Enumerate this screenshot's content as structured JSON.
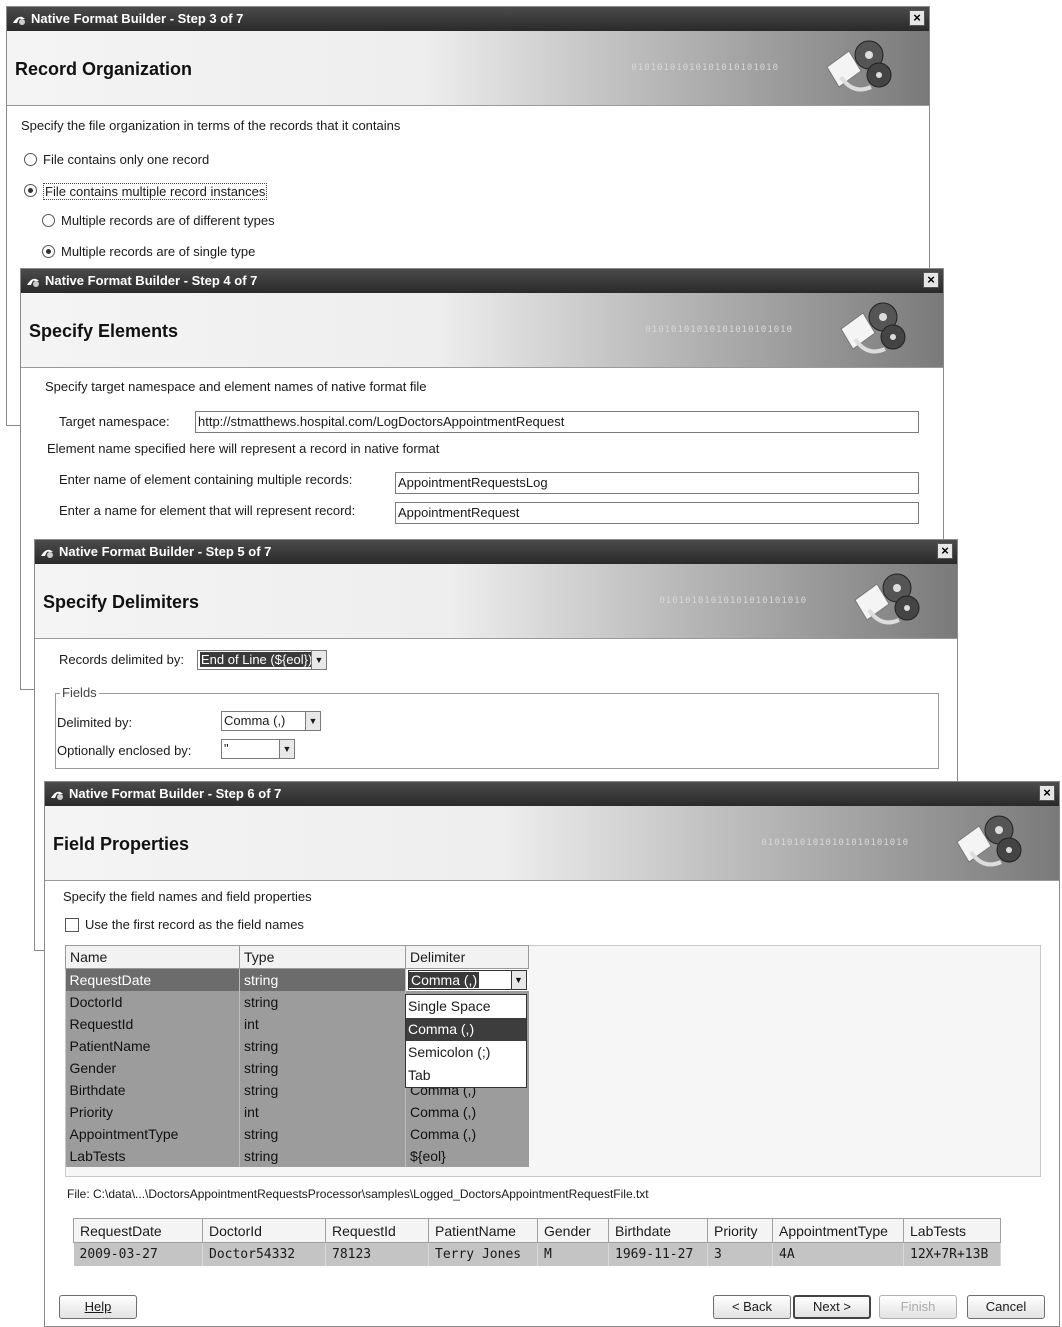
{
  "step3": {
    "title": "Native Format Builder - Step 3 of 7",
    "heading": "Record Organization",
    "instruction": "Specify the file organization in terms of the records that it contains",
    "options": [
      {
        "label": "File contains only one record",
        "selected": false
      },
      {
        "label": "File contains multiple record instances",
        "selected": true
      }
    ],
    "suboptions": [
      {
        "label": "Multiple records are of different types",
        "selected": false
      },
      {
        "label": "Multiple records are of single type",
        "selected": true
      }
    ]
  },
  "step4": {
    "title": "Native Format Builder - Step 4 of 7",
    "heading": "Specify Elements",
    "instruction": "Specify target namespace and element names of native format file",
    "namespace_label": "Target namespace:",
    "namespace_value": "http://stmatthews.hospital.com/LogDoctorsAppointmentRequest",
    "element_note": "Element name specified here will represent a record in native format",
    "multi_label": "Enter name of element containing multiple records:",
    "multi_value": "AppointmentRequestsLog",
    "record_label": "Enter a name for element that will represent record:",
    "record_value": "AppointmentRequest"
  },
  "step5": {
    "title": "Native Format Builder - Step 5 of 7",
    "heading": "Specify Delimiters",
    "records_label": "Records delimited by:",
    "records_value": "End of Line (${eol})",
    "fields_legend": "Fields",
    "delimited_label": "Delimited by:",
    "delimited_value": "Comma (,)",
    "enclosed_label": "Optionally enclosed by:",
    "enclosed_value": "\""
  },
  "step6": {
    "title": "Native Format Builder - Step 6 of 7",
    "heading": "Field Properties",
    "instruction": "Specify the field names and field properties",
    "first_record_label": "Use the first record as the field names",
    "columns": [
      "Name",
      "Type",
      "Delimiter"
    ],
    "rows": [
      {
        "name": "RequestDate",
        "type": "string",
        "delimiter": "Comma (,)"
      },
      {
        "name": "DoctorId",
        "type": "string",
        "delimiter": ""
      },
      {
        "name": "RequestId",
        "type": "int",
        "delimiter": ""
      },
      {
        "name": "PatientName",
        "type": "string",
        "delimiter": ""
      },
      {
        "name": "Gender",
        "type": "string",
        "delimiter": ""
      },
      {
        "name": "Birthdate",
        "type": "string",
        "delimiter": "Comma (,)"
      },
      {
        "name": "Priority",
        "type": "int",
        "delimiter": "Comma (,)"
      },
      {
        "name": "AppointmentType",
        "type": "string",
        "delimiter": "Comma (,)"
      },
      {
        "name": "LabTests",
        "type": "string",
        "delimiter": "${eol}"
      }
    ],
    "dropdown_options": [
      "Single Space",
      "Comma (,)",
      "Semicolon (;)",
      "Tab"
    ],
    "dropdown_selected": "Comma (,)",
    "file_label": "File: C:\\data\\...\\DoctorsAppointmentRequestsProcessor\\samples\\Logged_DoctorsAppointmentRequestFile.txt",
    "preview_columns": [
      "RequestDate",
      "DoctorId",
      "RequestId",
      "PatientName",
      "Gender",
      "Birthdate",
      "Priority",
      "AppointmentType",
      "LabTests"
    ],
    "preview_row": [
      "2009-03-27",
      "Doctor54332",
      "78123",
      "Terry Jones",
      "M",
      "1969-11-27",
      "3",
      "4A",
      "12X+7R+13B"
    ],
    "buttons": {
      "help": "Help",
      "back": "< Back",
      "next": "Next >",
      "finish": "Finish",
      "cancel": "Cancel"
    }
  },
  "close_glyph": "×",
  "banner_deco": "01010101010101010101010"
}
